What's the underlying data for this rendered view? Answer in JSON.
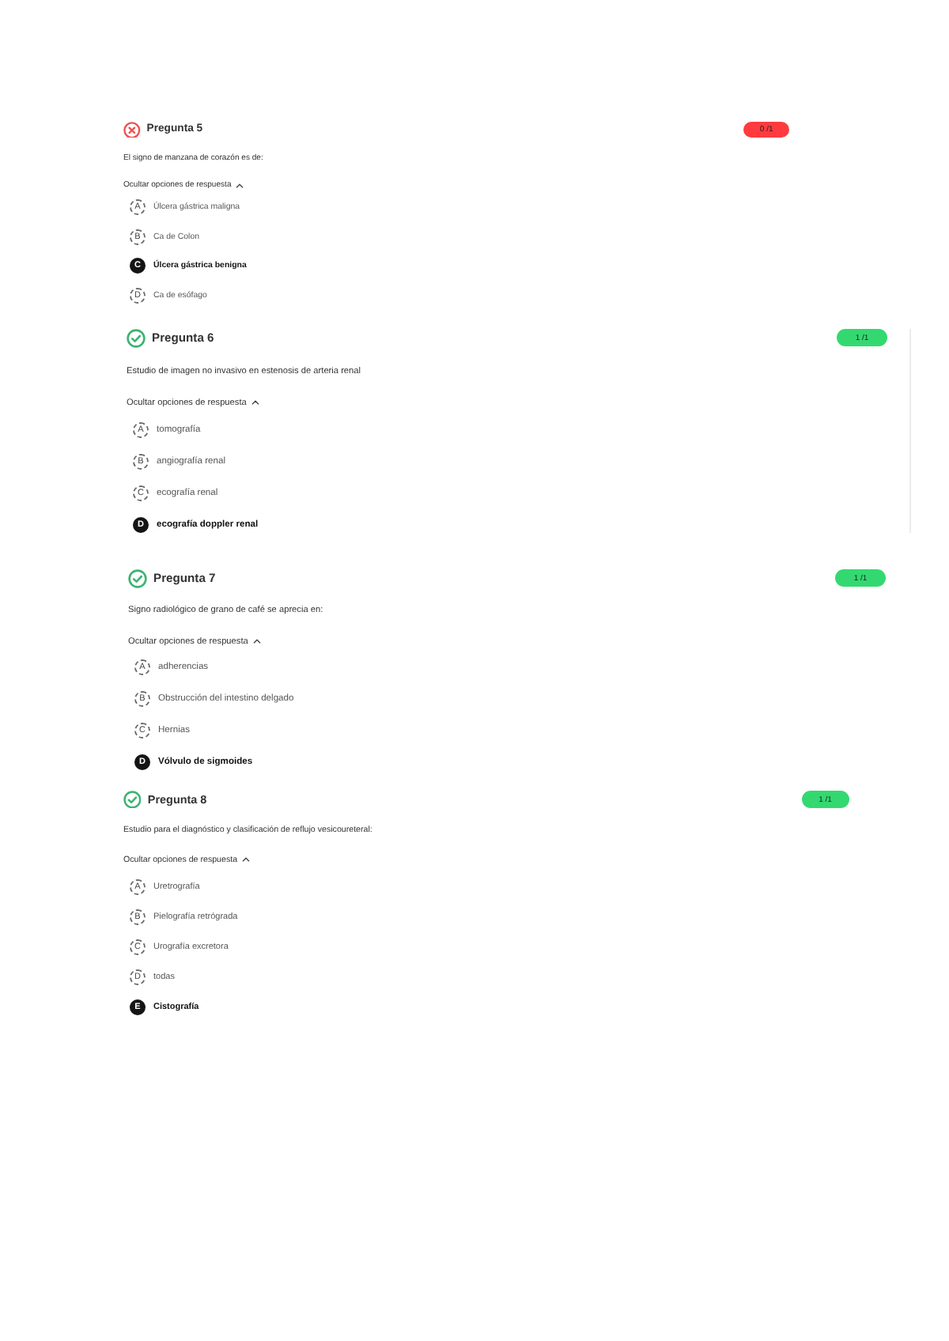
{
  "questions": [
    {
      "title": "Pregunta 5",
      "correct": false,
      "score": "0 /1",
      "prompt": "El signo de manzana de corazón es de:",
      "toggle": {
        "label": "Ocultar opciones de respuesta",
        "expanded": true
      },
      "options": [
        {
          "letter": "A",
          "text": "Úlcera gástrica maligna",
          "selected": false
        },
        {
          "letter": "B",
          "text": "Ca de Colon",
          "selected": false
        },
        {
          "letter": "C",
          "text": "Úlcera gástrica benigna",
          "selected": true
        },
        {
          "letter": "D",
          "text": "Ca de esófago",
          "selected": false
        }
      ]
    },
    {
      "title": "Pregunta 6",
      "correct": true,
      "score": "1 /1",
      "prompt": "Estudio de imagen no invasivo en estenosis de arteria renal",
      "toggle": {
        "label": "Ocultar opciones de respuesta",
        "expanded": true
      },
      "options": [
        {
          "letter": "A",
          "text": "tomografía",
          "selected": false
        },
        {
          "letter": "B",
          "text": "angiografía renal",
          "selected": false
        },
        {
          "letter": "C",
          "text": "ecografía renal",
          "selected": false
        },
        {
          "letter": "D",
          "text": "ecografía doppler renal",
          "selected": true
        }
      ]
    },
    {
      "title": "Pregunta 7",
      "correct": true,
      "score": "1 /1",
      "prompt": "Signo radiológico de grano de café se aprecia en:",
      "toggle": {
        "label": "Ocultar opciones de respuesta",
        "expanded": true
      },
      "options": [
        {
          "letter": "A",
          "text": "adherencias",
          "selected": false
        },
        {
          "letter": "B",
          "text": "Obstrucción del intestino delgado",
          "selected": false
        },
        {
          "letter": "C",
          "text": "Hernias",
          "selected": false
        },
        {
          "letter": "D",
          "text": "Vólvulo de sigmoides",
          "selected": true
        }
      ]
    },
    {
      "title": "Pregunta 8",
      "correct": true,
      "score": "1 /1",
      "prompt": "Estudio para el diagnóstico y clasificación de reflujo vesicoureteral:",
      "toggle": {
        "label": "Ocultar opciones de respuesta",
        "expanded": true
      },
      "options": [
        {
          "letter": "A",
          "text": "Uretrografía",
          "selected": false
        },
        {
          "letter": "B",
          "text": "Pielografía retrógrada",
          "selected": false
        },
        {
          "letter": "C",
          "text": "Urografía excretora",
          "selected": false
        },
        {
          "letter": "D",
          "text": "todas",
          "selected": false
        },
        {
          "letter": "E",
          "text": "Cistografía",
          "selected": true
        }
      ]
    }
  ]
}
